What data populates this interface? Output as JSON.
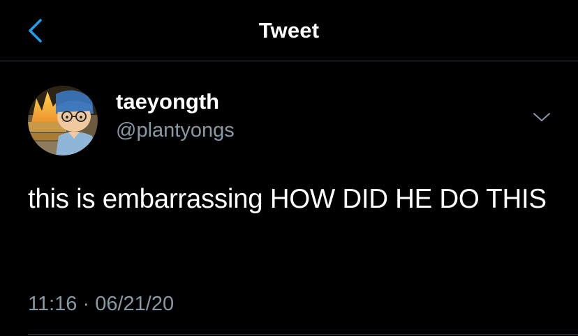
{
  "nav": {
    "title": "Tweet",
    "back_icon": "chevron-left-icon",
    "accent_color": "#1da1f2"
  },
  "tweet": {
    "author_name": "taeyongth",
    "author_handle": "@plantyongs",
    "avatar_icon": "avatar-image",
    "more_icon": "chevron-down-icon",
    "text": "this is embarrassing HOW DID HE DO THIS",
    "time": "11:16",
    "separator": "·",
    "date": "06/21/20"
  },
  "colors": {
    "background": "#000000",
    "primary_text": "#ffffff",
    "secondary_text": "#8899a6",
    "divider": "#38444d"
  }
}
